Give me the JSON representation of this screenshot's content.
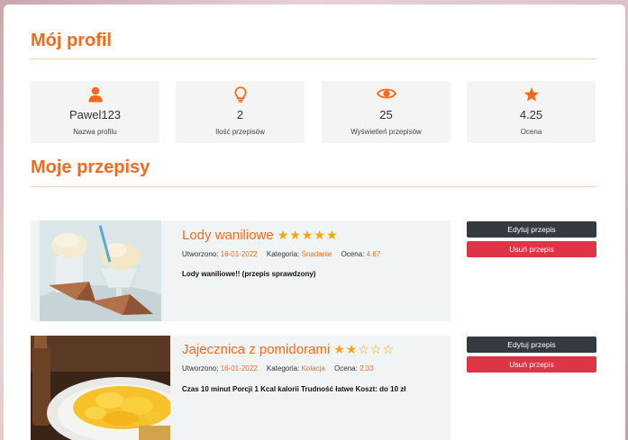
{
  "profile": {
    "heading": "Mój profil",
    "stats": [
      {
        "icon": "user-icon",
        "value": "Pawel123",
        "label": "Nazwa profilu"
      },
      {
        "icon": "lightbulb-icon",
        "value": "2",
        "label": "Ilość przepisów"
      },
      {
        "icon": "eye-icon",
        "value": "25",
        "label": "Wyświetleń przepisów"
      },
      {
        "icon": "star-icon",
        "value": "4.25",
        "label": "Ocena"
      }
    ]
  },
  "recipes": {
    "heading": "Moje przepisy",
    "items": [
      {
        "title": "Lody waniliowe",
        "stars": "★★★★★",
        "rating_value": 5,
        "created_label": "Utworzono:",
        "created": "16-01-2022",
        "category_label": "Kategoria:",
        "category": "Śnadanie",
        "rating_label": "Ocena:",
        "rating": "4.67",
        "description": "Lody waniliowe!! (przepis sprawdzony)",
        "edit_label": "Edytuj przepis",
        "delete_label": "Usuń przepis"
      },
      {
        "title": "Jajecznica z pomidorami",
        "stars": "★★☆☆☆",
        "rating_value": 2,
        "created_label": "Utworzono:",
        "created": "16-01-2022",
        "category_label": "Kategoria:",
        "category": "Kolacja",
        "rating_label": "Ocena:",
        "rating": "2.33",
        "description": "Czas 10 minut Porcji 1 Kcal kalorii Trudność łatwe Koszt: do 10 zł",
        "edit_label": "Edytuj przepis",
        "delete_label": "Usuń przepis"
      }
    ]
  },
  "colors": {
    "accent": "#f56a1a",
    "star": "#f5a400",
    "edit_button": "#343a40",
    "delete_button": "#dc3545"
  }
}
